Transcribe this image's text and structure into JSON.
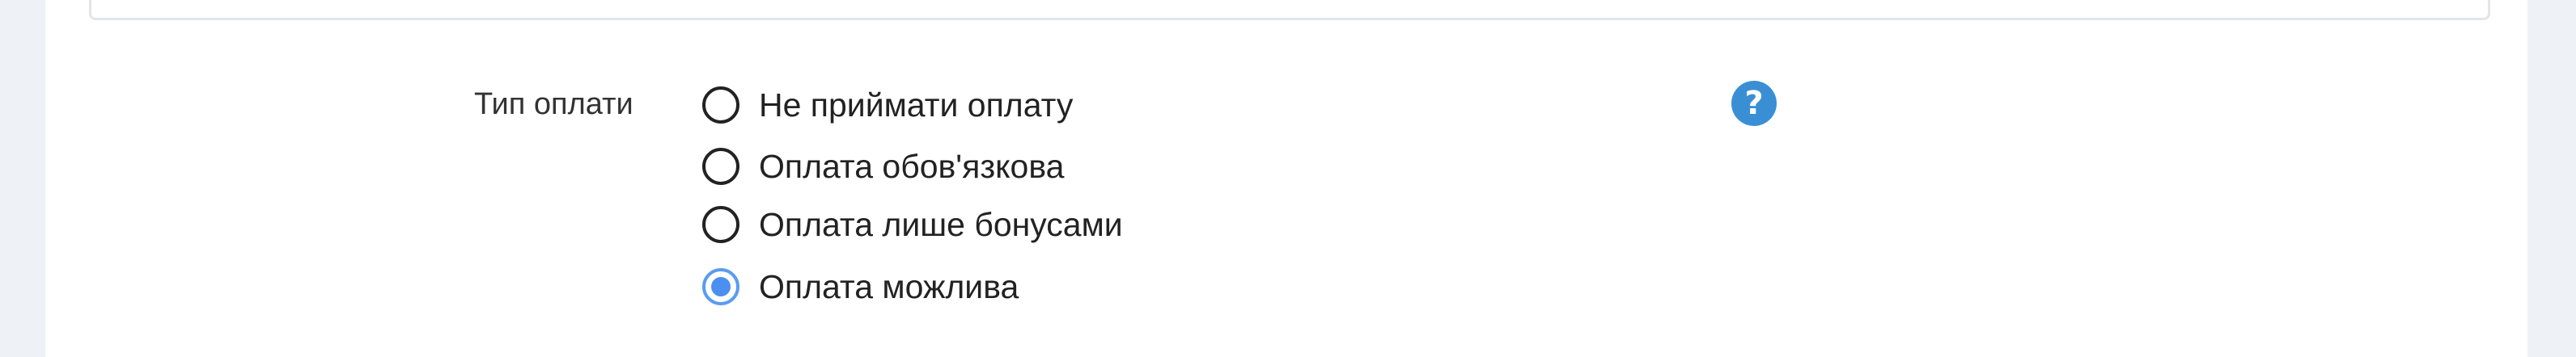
{
  "payment_type": {
    "label": "Тип оплати",
    "options": [
      {
        "label": "Не приймати оплату",
        "checked": false
      },
      {
        "label": "Оплата обов'язкова",
        "checked": false
      },
      {
        "label": "Оплата лише бонусами",
        "checked": false
      },
      {
        "label": "Оплата можлива",
        "checked": true
      }
    ],
    "help_icon": "question-circle-icon"
  },
  "colors": {
    "accent": "#4b8ff0",
    "help_icon": "#3a8fd4",
    "background": "#eef1f6"
  }
}
